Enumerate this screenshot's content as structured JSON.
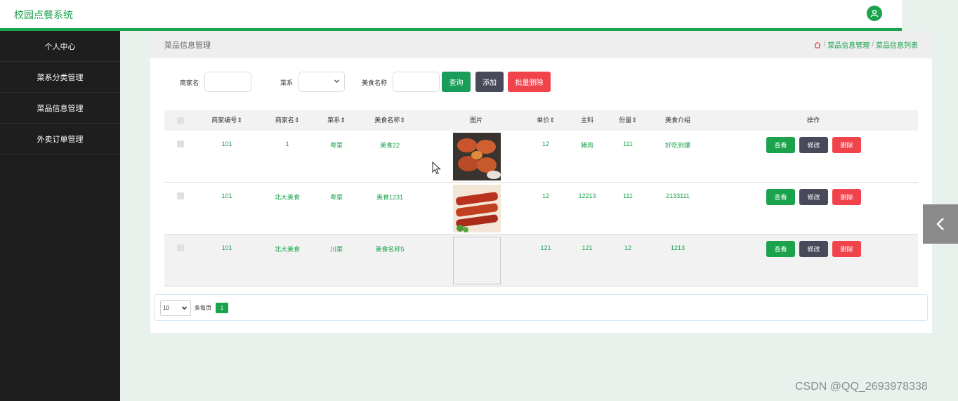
{
  "app": {
    "title": "校园点餐系统"
  },
  "sidebar": {
    "items": [
      {
        "label": "个人中心"
      },
      {
        "label": "菜系分类管理"
      },
      {
        "label": "菜品信息管理"
      },
      {
        "label": "外卖订单管理"
      }
    ]
  },
  "header": {
    "page_title": "菜品信息管理",
    "breadcrumb": [
      "菜品信息管理",
      "菜品信息列表"
    ],
    "breadcrumb_sep": "/"
  },
  "search": {
    "merchant_label": "商家名",
    "merchant_value": "",
    "cuisine_label": "菜系",
    "cuisine_value": "",
    "food_label": "美食名称",
    "food_value": "",
    "query_button": "查询",
    "add_button": "添加",
    "batch_delete_button": "批量删除"
  },
  "table": {
    "headers": {
      "merchant_no": "商家编号",
      "merchant": "商家名",
      "cuisine": "菜系",
      "food": "美食名称",
      "image": "图片",
      "price": "单价",
      "ingredient": "主料",
      "portion": "份量",
      "intro": "美食介绍",
      "ops": "操作"
    },
    "sort_icon": "sort-icon",
    "rows": [
      {
        "merchant_no": "101",
        "merchant": "1",
        "cuisine": "粤菜",
        "food": "美食22",
        "image": "crabs-photo",
        "price": "12",
        "ingredient": "猪肉",
        "portion": "111",
        "intro": "好吃到爆"
      },
      {
        "merchant_no": "101",
        "merchant": "北大美食",
        "cuisine": "粤菜",
        "food": "美食1231",
        "image": "skewers-photo",
        "price": "12",
        "ingredient": "12213",
        "portion": "111",
        "intro": "2133111"
      },
      {
        "merchant_no": "101",
        "merchant": "北大美食",
        "cuisine": "川菜",
        "food": "美食名称5",
        "image": "broken-image",
        "price": "121",
        "ingredient": "121",
        "portion": "12",
        "intro": "1213"
      }
    ],
    "ops": {
      "view": "查看",
      "edit": "修改",
      "delete": "删除"
    }
  },
  "pager": {
    "page_size": "10",
    "per_page_text": "条每页",
    "current_page": "1"
  },
  "watermark": "CSDN @QQ_2693978338",
  "colors": {
    "accent": "#1aa24c",
    "sidebar": "#1e1e1e",
    "danger": "#f0434c",
    "dark_button": "#484a5a"
  }
}
